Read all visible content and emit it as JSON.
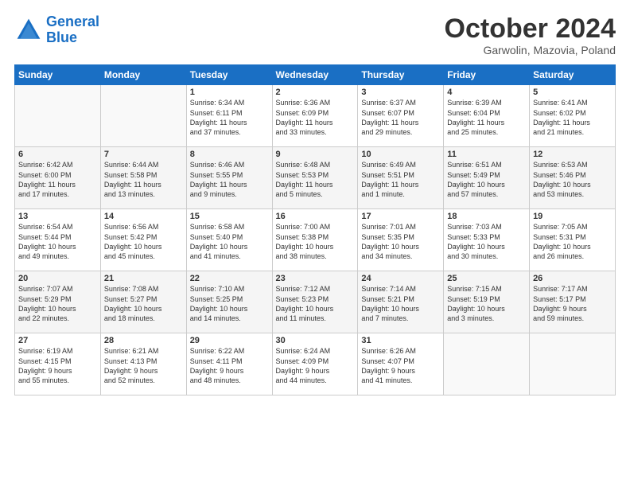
{
  "header": {
    "logo_line1": "General",
    "logo_line2": "Blue",
    "month": "October 2024",
    "location": "Garwolin, Mazovia, Poland"
  },
  "weekdays": [
    "Sunday",
    "Monday",
    "Tuesday",
    "Wednesday",
    "Thursday",
    "Friday",
    "Saturday"
  ],
  "weeks": [
    [
      {
        "day": "",
        "text": ""
      },
      {
        "day": "",
        "text": ""
      },
      {
        "day": "1",
        "text": "Sunrise: 6:34 AM\nSunset: 6:11 PM\nDaylight: 11 hours\nand 37 minutes."
      },
      {
        "day": "2",
        "text": "Sunrise: 6:36 AM\nSunset: 6:09 PM\nDaylight: 11 hours\nand 33 minutes."
      },
      {
        "day": "3",
        "text": "Sunrise: 6:37 AM\nSunset: 6:07 PM\nDaylight: 11 hours\nand 29 minutes."
      },
      {
        "day": "4",
        "text": "Sunrise: 6:39 AM\nSunset: 6:04 PM\nDaylight: 11 hours\nand 25 minutes."
      },
      {
        "day": "5",
        "text": "Sunrise: 6:41 AM\nSunset: 6:02 PM\nDaylight: 11 hours\nand 21 minutes."
      }
    ],
    [
      {
        "day": "6",
        "text": "Sunrise: 6:42 AM\nSunset: 6:00 PM\nDaylight: 11 hours\nand 17 minutes."
      },
      {
        "day": "7",
        "text": "Sunrise: 6:44 AM\nSunset: 5:58 PM\nDaylight: 11 hours\nand 13 minutes."
      },
      {
        "day": "8",
        "text": "Sunrise: 6:46 AM\nSunset: 5:55 PM\nDaylight: 11 hours\nand 9 minutes."
      },
      {
        "day": "9",
        "text": "Sunrise: 6:48 AM\nSunset: 5:53 PM\nDaylight: 11 hours\nand 5 minutes."
      },
      {
        "day": "10",
        "text": "Sunrise: 6:49 AM\nSunset: 5:51 PM\nDaylight: 11 hours\nand 1 minute."
      },
      {
        "day": "11",
        "text": "Sunrise: 6:51 AM\nSunset: 5:49 PM\nDaylight: 10 hours\nand 57 minutes."
      },
      {
        "day": "12",
        "text": "Sunrise: 6:53 AM\nSunset: 5:46 PM\nDaylight: 10 hours\nand 53 minutes."
      }
    ],
    [
      {
        "day": "13",
        "text": "Sunrise: 6:54 AM\nSunset: 5:44 PM\nDaylight: 10 hours\nand 49 minutes."
      },
      {
        "day": "14",
        "text": "Sunrise: 6:56 AM\nSunset: 5:42 PM\nDaylight: 10 hours\nand 45 minutes."
      },
      {
        "day": "15",
        "text": "Sunrise: 6:58 AM\nSunset: 5:40 PM\nDaylight: 10 hours\nand 41 minutes."
      },
      {
        "day": "16",
        "text": "Sunrise: 7:00 AM\nSunset: 5:38 PM\nDaylight: 10 hours\nand 38 minutes."
      },
      {
        "day": "17",
        "text": "Sunrise: 7:01 AM\nSunset: 5:35 PM\nDaylight: 10 hours\nand 34 minutes."
      },
      {
        "day": "18",
        "text": "Sunrise: 7:03 AM\nSunset: 5:33 PM\nDaylight: 10 hours\nand 30 minutes."
      },
      {
        "day": "19",
        "text": "Sunrise: 7:05 AM\nSunset: 5:31 PM\nDaylight: 10 hours\nand 26 minutes."
      }
    ],
    [
      {
        "day": "20",
        "text": "Sunrise: 7:07 AM\nSunset: 5:29 PM\nDaylight: 10 hours\nand 22 minutes."
      },
      {
        "day": "21",
        "text": "Sunrise: 7:08 AM\nSunset: 5:27 PM\nDaylight: 10 hours\nand 18 minutes."
      },
      {
        "day": "22",
        "text": "Sunrise: 7:10 AM\nSunset: 5:25 PM\nDaylight: 10 hours\nand 14 minutes."
      },
      {
        "day": "23",
        "text": "Sunrise: 7:12 AM\nSunset: 5:23 PM\nDaylight: 10 hours\nand 11 minutes."
      },
      {
        "day": "24",
        "text": "Sunrise: 7:14 AM\nSunset: 5:21 PM\nDaylight: 10 hours\nand 7 minutes."
      },
      {
        "day": "25",
        "text": "Sunrise: 7:15 AM\nSunset: 5:19 PM\nDaylight: 10 hours\nand 3 minutes."
      },
      {
        "day": "26",
        "text": "Sunrise: 7:17 AM\nSunset: 5:17 PM\nDaylight: 9 hours\nand 59 minutes."
      }
    ],
    [
      {
        "day": "27",
        "text": "Sunrise: 6:19 AM\nSunset: 4:15 PM\nDaylight: 9 hours\nand 55 minutes."
      },
      {
        "day": "28",
        "text": "Sunrise: 6:21 AM\nSunset: 4:13 PM\nDaylight: 9 hours\nand 52 minutes."
      },
      {
        "day": "29",
        "text": "Sunrise: 6:22 AM\nSunset: 4:11 PM\nDaylight: 9 hours\nand 48 minutes."
      },
      {
        "day": "30",
        "text": "Sunrise: 6:24 AM\nSunset: 4:09 PM\nDaylight: 9 hours\nand 44 minutes."
      },
      {
        "day": "31",
        "text": "Sunrise: 6:26 AM\nSunset: 4:07 PM\nDaylight: 9 hours\nand 41 minutes."
      },
      {
        "day": "",
        "text": ""
      },
      {
        "day": "",
        "text": ""
      }
    ]
  ]
}
